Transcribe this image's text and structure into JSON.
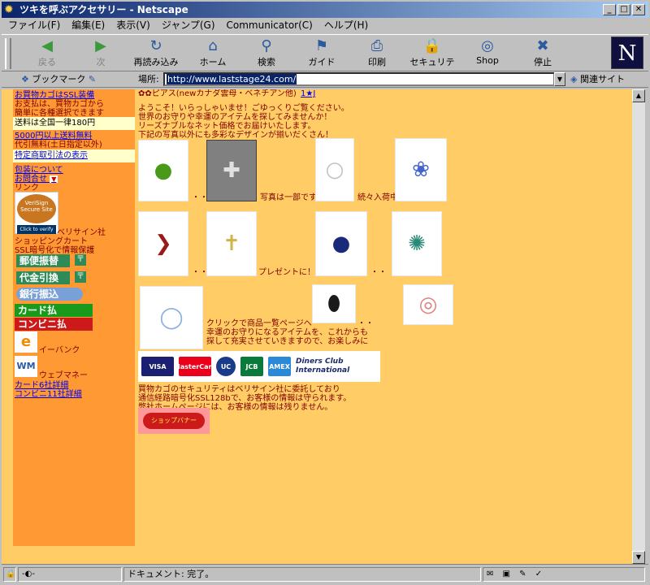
{
  "window": {
    "title": "ツキを呼ぶアクセサリー - Netscape"
  },
  "menu": [
    "ファイル(F)",
    "編集(E)",
    "表示(V)",
    "ジャンプ(G)",
    "Communicator(C)",
    "ヘルプ(H)"
  ],
  "toolbar": [
    {
      "label": "戻る",
      "icon": "back-arrow-icon",
      "glyph": "◀"
    },
    {
      "label": "次",
      "icon": "forward-arrow-icon",
      "glyph": "▶"
    },
    {
      "label": "再読み込み",
      "icon": "reload-icon",
      "glyph": "↻"
    },
    {
      "label": "ホーム",
      "icon": "home-icon",
      "glyph": "⌂"
    },
    {
      "label": "検索",
      "icon": "search-icon",
      "glyph": "⚲"
    },
    {
      "label": "ガイド",
      "icon": "guide-icon",
      "glyph": "⚑"
    },
    {
      "label": "印刷",
      "icon": "print-icon",
      "glyph": "⎙"
    },
    {
      "label": "セキュリティ",
      "icon": "security-lock-icon",
      "glyph": "🔒"
    },
    {
      "label": "Shop",
      "icon": "shop-icon",
      "glyph": "◎"
    },
    {
      "label": "停止",
      "icon": "stop-icon",
      "glyph": "✖"
    }
  ],
  "location": {
    "bookmarks_label": "ブックマーク",
    "location_label": "場所:",
    "url": "http://www.laststage24.com/",
    "related_label": "関連サイト"
  },
  "sidebar": {
    "ssl_title": "お買物カゴはSSL装備",
    "ssl_desc_1": "お支払は、買物カゴから",
    "ssl_desc_2": "簡単に各種選択できます",
    "shipping": "送料は全国一律180円",
    "free_shipping": "5000円以上送料無料",
    "cod_free": "代引無料(土日指定以外)",
    "tokutei": "特定商取引法の表示",
    "packaging": "包装について",
    "contact": "お問合せ",
    "links": "リンク",
    "verisign_logo": "VeriSign Secure Site",
    "verisign_caption": "Click to verify",
    "verisign": "ベリサイン社",
    "shopping_cart": "ショッピングカート",
    "ssl_enc": "SSL暗号化で情報保護",
    "postal_transfer": "郵便振替",
    "cod": "代金引換",
    "bank_transfer": "銀行振込",
    "card_pay": "カード払",
    "conv_pay": "コンビニ払",
    "ebank": "イーバンク",
    "webmoney": "ウェブマネー",
    "card_detail": "カード6社詳細",
    "conv_detail": "コンビニ11社詳細"
  },
  "main": {
    "header": "ピアス(newカナダ雲母・ベネチアン他)",
    "header_link": "1★J",
    "welcome_1": "ようこそ！いらっしゃいませ！ごゆっくりご覧ください。",
    "welcome_2": "世界のお守りや幸運のアイテムを探してみませんか！",
    "welcome_3": "リーズナブルなネット価格でお届けいたします。",
    "welcome_4": "下記の写真以外にも多彩なデザインが揃いだくさん！",
    "dots": "・・",
    "photo_note": "写真は一部です",
    "coming": "続々入荷中",
    "present": "プレゼントに！",
    "click_1": "クリックで商品一覧ページへ",
    "click_2": "幸運のお守りになるアイテムを、これからも",
    "click_3": "探して充実させていきますので、お楽しみに",
    "security_1": "買物カゴのセキュリティはベリサイン社に委託しており",
    "security_2": "通信経路暗号化SSL128bで、お客様の情報は守られます。",
    "security_3": "弊社ホームページには、お客様の情報は残りません。",
    "cards": [
      "VISA",
      "MasterCard",
      "UC",
      "JCB",
      "AMEX",
      "Diners Club International"
    ],
    "banner": "ショップバナー"
  },
  "status": {
    "text": "ドキュメント: 完了。"
  },
  "colors": {
    "page_bg": "#ffcc66",
    "sidebar_bg": "#ff9933",
    "text": "#800000",
    "link": "#0000ee"
  }
}
